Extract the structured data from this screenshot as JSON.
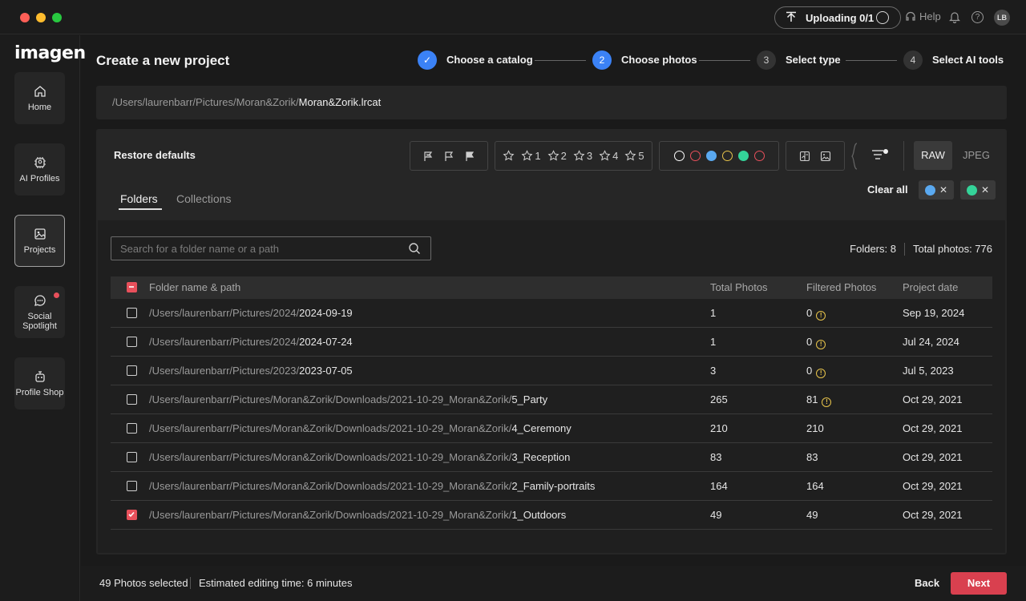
{
  "titlebar": {
    "upload_label": "Uploading 0/1",
    "help_label": "Help",
    "avatar_initials": "LB"
  },
  "sidebar": {
    "logo": "imagen",
    "items": [
      {
        "label": "Home",
        "icon": "home-icon"
      },
      {
        "label": "AI Profiles",
        "icon": "ai-profile-icon"
      },
      {
        "label": "Projects",
        "icon": "projects-icon",
        "active": true
      },
      {
        "label": "Social Spotlight",
        "icon": "chat-icon",
        "badge": true
      },
      {
        "label": "Profile Shop",
        "icon": "shop-icon"
      }
    ]
  },
  "header": {
    "title": "Create a new project"
  },
  "stepper": [
    {
      "number": "✓",
      "label": "Choose a catalog",
      "state": "done"
    },
    {
      "number": "2",
      "label": "Choose photos",
      "state": "current"
    },
    {
      "number": "3",
      "label": "Select type",
      "state": "todo"
    },
    {
      "number": "4",
      "label": "Select AI tools",
      "state": "todo"
    }
  ],
  "catalog_path": {
    "dir": "/Users/laurenbarr/Pictures/Moran&Zorik/",
    "file": "Moran&Zorik.lrcat"
  },
  "filters": {
    "restore_label": "Restore defaults",
    "stars": [
      "1",
      "2",
      "3",
      "4",
      "5"
    ],
    "color_dots": [
      "#ffffff",
      "#e8505b",
      "#5aa9f0",
      "#e8c44b",
      "#34d399",
      "#e8505b"
    ],
    "raw_label": "RAW",
    "jpeg_label": "JPEG",
    "clear_all_label": "Clear all",
    "active_chips": [
      "#5aa9f0",
      "#34d399"
    ]
  },
  "tabs": [
    {
      "label": "Folders",
      "active": true
    },
    {
      "label": "Collections",
      "active": false
    }
  ],
  "search": {
    "placeholder": "Search for a folder name or a path",
    "value": ""
  },
  "counts": {
    "folders": "Folders: 8",
    "total": "Total photos: 776"
  },
  "table": {
    "headers": {
      "path": "Folder name & path",
      "total": "Total Photos",
      "filtered": "Filtered Photos",
      "date": "Project date"
    },
    "rows": [
      {
        "dir": "/Users/laurenbarr/Pictures/2024/",
        "name": "2024-09-19",
        "total": "1",
        "filtered": "0",
        "warn": true,
        "date": "Sep 19, 2024",
        "checked": false
      },
      {
        "dir": "/Users/laurenbarr/Pictures/2024/",
        "name": "2024-07-24",
        "total": "1",
        "filtered": "0",
        "warn": true,
        "date": "Jul 24, 2024",
        "checked": false
      },
      {
        "dir": "/Users/laurenbarr/Pictures/2023/",
        "name": "2023-07-05",
        "total": "3",
        "filtered": "0",
        "warn": true,
        "date": "Jul 5, 2023",
        "checked": false
      },
      {
        "dir": "/Users/laurenbarr/Pictures/Moran&Zorik/Downloads/2021-10-29_Moran&Zorik/",
        "name": "5_Party",
        "total": "265",
        "filtered": "81",
        "warn": true,
        "date": "Oct 29, 2021",
        "checked": false
      },
      {
        "dir": "/Users/laurenbarr/Pictures/Moran&Zorik/Downloads/2021-10-29_Moran&Zorik/",
        "name": "4_Ceremony",
        "total": "210",
        "filtered": "210",
        "warn": false,
        "date": "Oct 29, 2021",
        "checked": false
      },
      {
        "dir": "/Users/laurenbarr/Pictures/Moran&Zorik/Downloads/2021-10-29_Moran&Zorik/",
        "name": "3_Reception",
        "total": "83",
        "filtered": "83",
        "warn": false,
        "date": "Oct 29, 2021",
        "checked": false
      },
      {
        "dir": "/Users/laurenbarr/Pictures/Moran&Zorik/Downloads/2021-10-29_Moran&Zorik/",
        "name": "2_Family-portraits",
        "total": "164",
        "filtered": "164",
        "warn": false,
        "date": "Oct 29, 2021",
        "checked": false
      },
      {
        "dir": "/Users/laurenbarr/Pictures/Moran&Zorik/Downloads/2021-10-29_Moran&Zorik/",
        "name": "1_Outdoors",
        "total": "49",
        "filtered": "49",
        "warn": false,
        "date": "Oct 29, 2021",
        "checked": true
      }
    ]
  },
  "footer": {
    "selected": "49 Photos selected",
    "estimate": "Estimated editing time: 6 minutes",
    "back_label": "Back",
    "next_label": "Next"
  }
}
